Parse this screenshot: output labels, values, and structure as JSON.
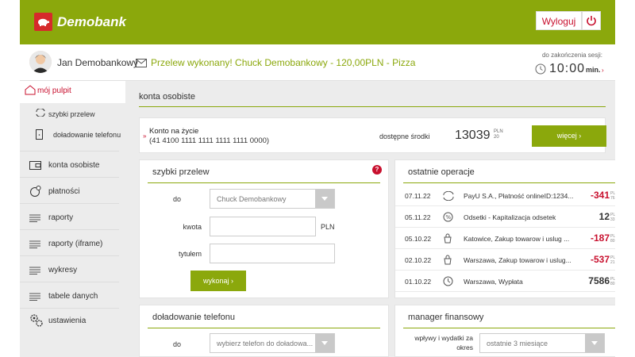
{
  "brand": {
    "name": "Demobank"
  },
  "header": {
    "logout_label": "Wyloguj"
  },
  "user": {
    "name": "Jan Demobankowy",
    "message": "Przelew wykonany! Chuck Demobankowy - 120,00PLN - Pizza",
    "session_label": "do zakończenia sesji:",
    "session_time": "10:00",
    "session_unit": "min."
  },
  "sidebar": {
    "active": "mój pulpit",
    "subitems": [
      "szybki przelew",
      "doładowanie telefonu"
    ],
    "items": [
      "konta osobiste",
      "płatności",
      "raporty",
      "raporty (iframe)",
      "wykresy",
      "tabele danych",
      "ustawienia"
    ]
  },
  "main": {
    "title": "konta osobiste"
  },
  "account": {
    "name": "Konto na życie",
    "number": "(41 4100 1111 1111 1111 1111 0000)",
    "available_label": "dostępne środki",
    "amount": "13039",
    "amount_dec": "20",
    "currency": "PLN",
    "more_label": "więcej"
  },
  "quick_transfer": {
    "title": "szybki przelew",
    "to_label": "do",
    "to_value": "Chuck Demobankowy",
    "amount_label": "kwota",
    "currency": "PLN",
    "title_label": "tytułem",
    "submit_label": "wykonaj"
  },
  "operations": {
    "title": "ostatnie operacje",
    "rows": [
      {
        "date": "07.11.22",
        "desc": "PayU S.A., Płatność onlineID:1234...",
        "amount": "-341",
        "dec": "76",
        "negative": true
      },
      {
        "date": "05.11.22",
        "desc": "Odsetki - Kapitalizacja odsetek",
        "amount": "12",
        "dec": "33",
        "negative": false
      },
      {
        "date": "05.10.22",
        "desc": "Katowice, Zakup towarow i uslug ...",
        "amount": "-187",
        "dec": "80",
        "negative": true
      },
      {
        "date": "02.10.22",
        "desc": "Warszawa, Zakup towarow i uslug...",
        "amount": "-537",
        "dec": "21",
        "negative": true
      },
      {
        "date": "01.10.22",
        "desc": "Warszawa, Wypłata",
        "amount": "7586",
        "dec": "80",
        "negative": false
      }
    ]
  },
  "phone_topup": {
    "title": "doładowanie telefonu",
    "to_label": "do",
    "select_placeholder": "wybierz telefon do doładowa..."
  },
  "finance_manager": {
    "title": "manager finansowy",
    "label": "wpływy i wydatki za okres",
    "period": "ostatnie 3 miesiące"
  },
  "colors": {
    "brand_green": "#8ba80c",
    "accent_red": "#c8102e"
  }
}
